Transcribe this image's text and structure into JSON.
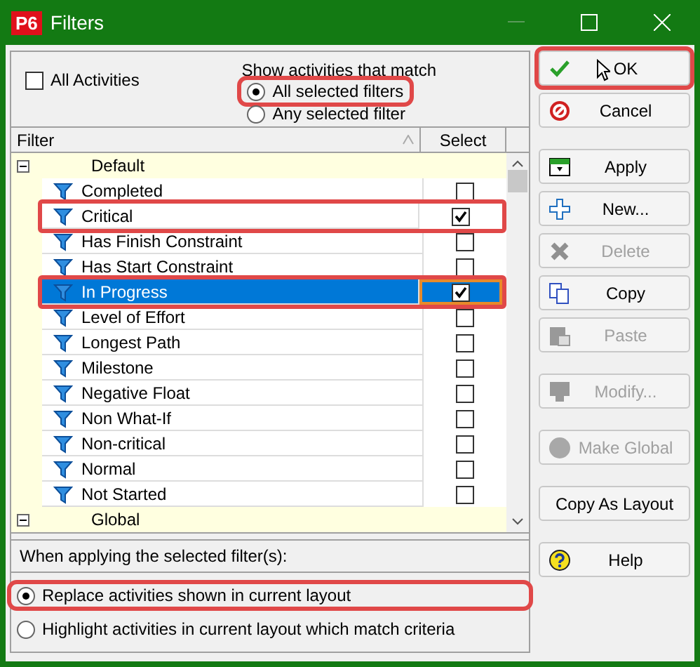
{
  "window": {
    "logo": "P6",
    "title": "Filters"
  },
  "all_activities": {
    "label": "All Activities",
    "checked": false
  },
  "match": {
    "label": "Show activities that match",
    "options": [
      {
        "label": "All selected filters",
        "selected": true,
        "highlighted": true
      },
      {
        "label": "Any selected filter",
        "selected": false,
        "highlighted": false
      }
    ]
  },
  "table": {
    "columns": [
      "Filter",
      "Select"
    ],
    "groups": [
      {
        "name": "Default",
        "expanded": true,
        "children": [
          {
            "name": "Completed",
            "checked": false,
            "selected": false,
            "highlighted": false
          },
          {
            "name": "Critical",
            "checked": true,
            "selected": false,
            "highlighted": true
          },
          {
            "name": "Has Finish Constraint",
            "checked": false,
            "selected": false,
            "highlighted": false
          },
          {
            "name": "Has Start Constraint",
            "checked": false,
            "selected": false,
            "highlighted": false
          },
          {
            "name": "In Progress",
            "checked": true,
            "selected": true,
            "highlighted": true
          },
          {
            "name": "Level of Effort",
            "checked": false,
            "selected": false,
            "highlighted": false
          },
          {
            "name": "Longest Path",
            "checked": false,
            "selected": false,
            "highlighted": false
          },
          {
            "name": "Milestone",
            "checked": false,
            "selected": false,
            "highlighted": false
          },
          {
            "name": "Negative Float",
            "checked": false,
            "selected": false,
            "highlighted": false
          },
          {
            "name": "Non What-If",
            "checked": false,
            "selected": false,
            "highlighted": false
          },
          {
            "name": "Non-critical",
            "checked": false,
            "selected": false,
            "highlighted": false
          },
          {
            "name": "Normal",
            "checked": false,
            "selected": false,
            "highlighted": false
          },
          {
            "name": "Not Started",
            "checked": false,
            "selected": false,
            "highlighted": false
          }
        ]
      },
      {
        "name": "Global",
        "expanded": true
      }
    ]
  },
  "apply_mode": {
    "label": "When applying the selected filter(s):",
    "options": [
      {
        "label": "Replace activities shown in current layout",
        "selected": true,
        "highlighted": true
      },
      {
        "label": "Highlight activities in current layout which match criteria",
        "selected": false,
        "highlighted": false
      }
    ]
  },
  "button_groups": [
    [
      {
        "label": "OK",
        "kind": "check",
        "disabled": false,
        "highlighted": true
      },
      {
        "label": "Cancel",
        "kind": "cancel",
        "disabled": false,
        "highlighted": false
      }
    ],
    [
      {
        "label": "Apply",
        "kind": "apply",
        "disabled": false,
        "highlighted": false
      },
      {
        "label": "New...",
        "kind": "plus",
        "disabled": false,
        "highlighted": false
      },
      {
        "label": "Delete",
        "kind": "delete",
        "disabled": true,
        "highlighted": false
      },
      {
        "label": "Copy",
        "kind": "copy",
        "disabled": false,
        "highlighted": false
      },
      {
        "label": "Paste",
        "kind": "paste",
        "disabled": true,
        "highlighted": false
      }
    ],
    [
      {
        "label": "Modify...",
        "kind": "monitor",
        "disabled": true,
        "highlighted": false
      }
    ],
    [
      {
        "label": "Make Global",
        "kind": "globe",
        "disabled": true,
        "highlighted": false
      }
    ],
    [
      {
        "label": "Copy As Layout",
        "kind": "none",
        "disabled": false,
        "highlighted": false
      }
    ],
    [
      {
        "label": "Help",
        "kind": "help",
        "disabled": false,
        "highlighted": false
      }
    ]
  ]
}
